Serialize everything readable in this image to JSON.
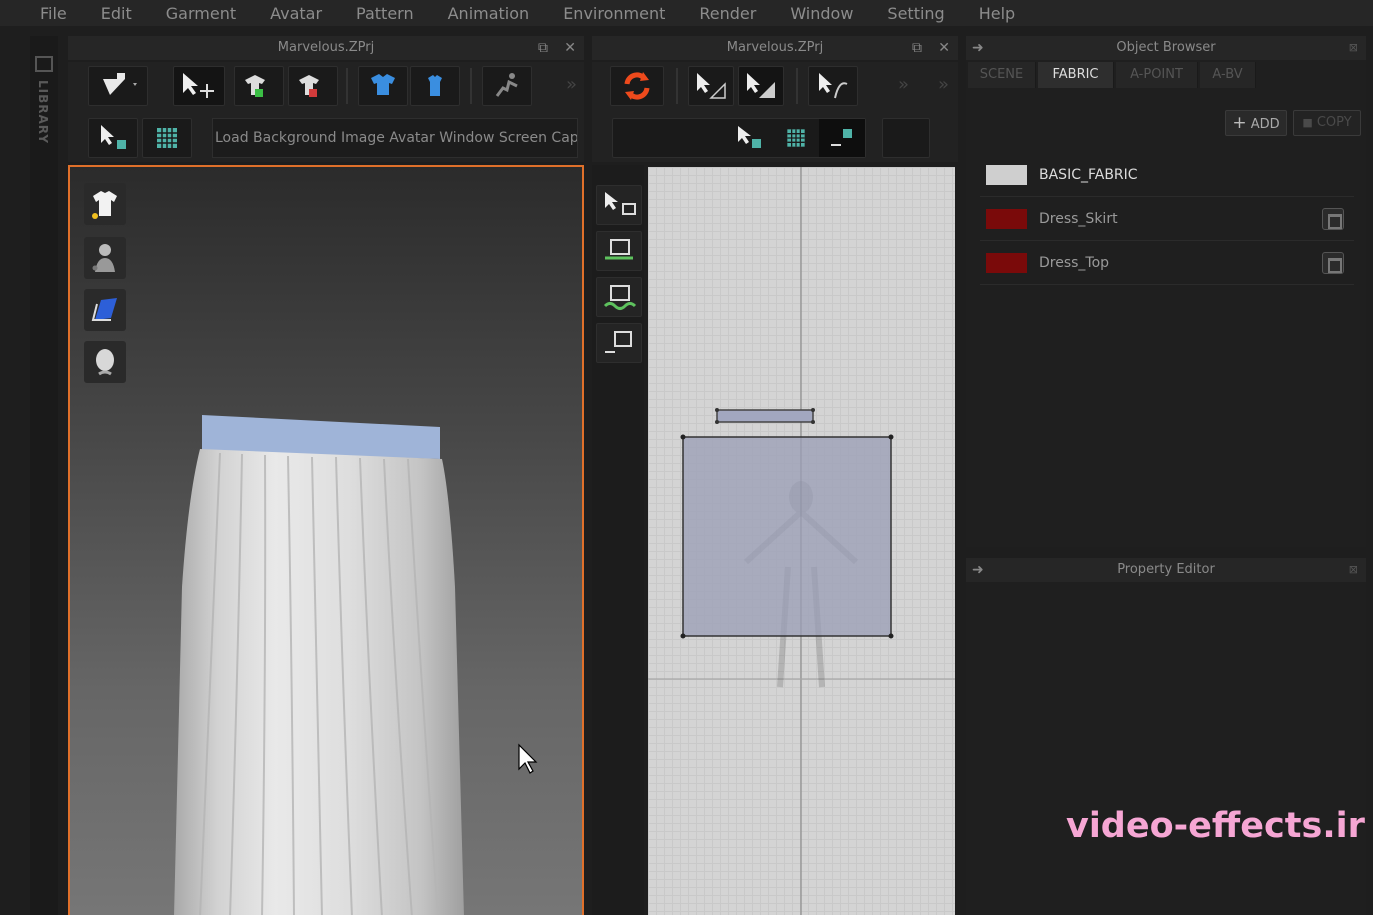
{
  "menu": [
    "File",
    "Edit",
    "Garment",
    "Avatar",
    "Pattern",
    "Animation",
    "Environment",
    "Render",
    "Window",
    "Setting",
    "Help"
  ],
  "library": {
    "label": "LIBRARY"
  },
  "view3d": {
    "title": "Marvelous.ZPrj",
    "bg_button_label": "Load Background Image Avatar Window Screen Capture"
  },
  "view2d": {
    "title": "Marvelous.ZPrj"
  },
  "object_browser": {
    "title": "Object Browser",
    "tabs": [
      "SCENE",
      "FABRIC",
      "A-POINT",
      "A-BV"
    ],
    "active_tab": "FABRIC",
    "add_label": "ADD",
    "copy_label": "COPY",
    "fabrics": [
      {
        "name": "BASIC_FABRIC",
        "color": "#cfcfcf"
      },
      {
        "name": "Dress_Skirt",
        "color": "#7a0a0a"
      },
      {
        "name": "Dress_Top",
        "color": "#7a0a0a"
      }
    ]
  },
  "property_editor": {
    "title": "Property Editor"
  },
  "watermark": "video-effects.ir",
  "colors": {
    "viewport_border": "#e0702a",
    "pattern_fill": "#9a9db5",
    "waistband": "#9fb4d8"
  }
}
